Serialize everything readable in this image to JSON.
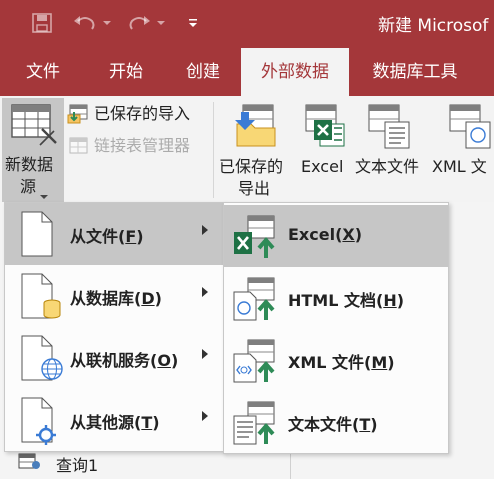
{
  "window": {
    "title": "新建 Microsof"
  },
  "tabs": [
    {
      "label": "文件"
    },
    {
      "label": "开始"
    },
    {
      "label": "创建"
    },
    {
      "label": "外部数据"
    },
    {
      "label": "数据库工具"
    }
  ],
  "ribbon": {
    "new_data_source": {
      "line1": "新数据",
      "line2": "源"
    },
    "saved_imports": "已保存的导入",
    "linked_table_manager": "链接表管理器",
    "export": {
      "saved_exports": {
        "line1": "已保存的",
        "line2": "导出"
      },
      "excel": "Excel",
      "text_file": "文本文件",
      "xml_file": "XML 文"
    }
  },
  "menu_sources": [
    {
      "label": "从文件",
      "key": "F"
    },
    {
      "label": "从数据库",
      "key": "D"
    },
    {
      "label": "从联机服务",
      "key": "O"
    },
    {
      "label": "从其他源",
      "key": "T"
    }
  ],
  "menu_file": [
    {
      "label": "Excel",
      "key": "X"
    },
    {
      "label": "HTML 文档",
      "key": "H"
    },
    {
      "label": "XML 文件",
      "key": "M"
    },
    {
      "label": "文本文件",
      "key": "T"
    }
  ],
  "navpane": {
    "query_item": "查询1"
  },
  "colors": {
    "accent": "#a4373a",
    "excel_green": "#1e7145",
    "highlight": "#c6c6c6"
  }
}
